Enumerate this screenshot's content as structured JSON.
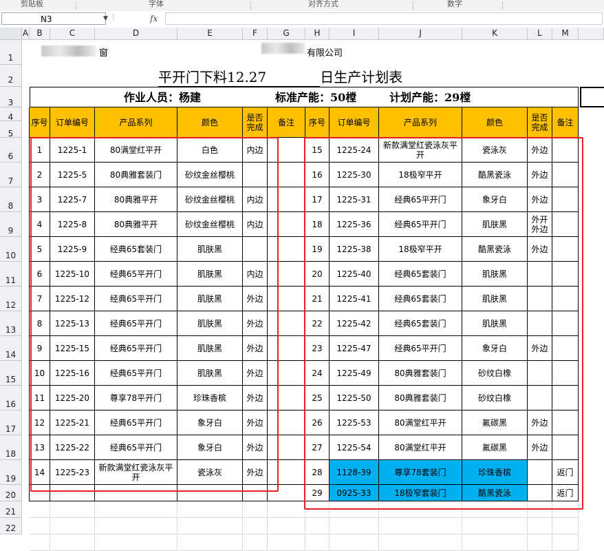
{
  "ribbon": {
    "groups": [
      "剪贴板",
      "字体",
      "对齐方式",
      "数字"
    ]
  },
  "formula_bar": {
    "name_box": "N3",
    "fx_label": "fx",
    "formula": ""
  },
  "columns": [
    "A",
    "B",
    "C",
    "D",
    "E",
    "F",
    "G",
    "H",
    "I",
    "J",
    "K",
    "L",
    "M"
  ],
  "rows": [
    "1",
    "2",
    "3",
    "4",
    "5",
    "6",
    "7",
    "8",
    "9",
    "10",
    "11",
    "12",
    "13",
    "14",
    "15",
    "16",
    "17",
    "18",
    "19",
    "20",
    "21",
    "22"
  ],
  "sheet": {
    "company_tail": "有限公司",
    "company_head_char": "窗",
    "title_prefix": "平开门下料12.27",
    "title_suffix": "日生产计划表",
    "worker": "作业人员：杨建",
    "standard_capacity": "标准产能：50樘",
    "planned_capacity": "计划产能：29樘"
  },
  "headers": [
    "序号",
    "订单编号",
    "产品系列",
    "颜色",
    "是否完成",
    "备注"
  ],
  "left_rows": [
    {
      "no": "1",
      "order": "1225-1",
      "series": "80满堂红平开",
      "color": "白色",
      "done": "内边",
      "note": ""
    },
    {
      "no": "2",
      "order": "1225-5",
      "series": "80典雅套装门",
      "color": "砂纹金丝樱桃",
      "done": "",
      "note": ""
    },
    {
      "no": "3",
      "order": "1225-7",
      "series": "80典雅平开",
      "color": "砂纹金丝樱桃",
      "done": "内边",
      "note": ""
    },
    {
      "no": "4",
      "order": "1225-8",
      "series": "80典雅平开",
      "color": "砂纹金丝樱桃",
      "done": "内边",
      "note": ""
    },
    {
      "no": "5",
      "order": "1225-9",
      "series": "经典65套装门",
      "color": "肌肤黑",
      "done": "",
      "note": ""
    },
    {
      "no": "6",
      "order": "1225-10",
      "series": "经典65平开门",
      "color": "肌肤黑",
      "done": "内边",
      "note": ""
    },
    {
      "no": "7",
      "order": "1225-12",
      "series": "经典65平开门",
      "color": "肌肤黑",
      "done": "外边",
      "note": ""
    },
    {
      "no": "8",
      "order": "1225-13",
      "series": "经典65平开门",
      "color": "肌肤黑",
      "done": "外边",
      "note": ""
    },
    {
      "no": "9",
      "order": "1225-15",
      "series": "经典65平开门",
      "color": "肌肤黑",
      "done": "外边",
      "note": ""
    },
    {
      "no": "10",
      "order": "1225-16",
      "series": "经典65平开门",
      "color": "肌肤黑",
      "done": "外边",
      "note": ""
    },
    {
      "no": "11",
      "order": "1225-20",
      "series": "尊享78平开门",
      "color": "珍珠香槟",
      "done": "外边",
      "note": ""
    },
    {
      "no": "12",
      "order": "1225-21",
      "series": "经典65平开门",
      "color": "象牙白",
      "done": "外边",
      "note": ""
    },
    {
      "no": "13",
      "order": "1225-22",
      "series": "经典65平开门",
      "color": "象牙白",
      "done": "外边",
      "note": ""
    },
    {
      "no": "14",
      "order": "1225-23",
      "series": "新款满堂红瓷泳灰平开",
      "color": "瓷泳灰",
      "done": "外边",
      "note": ""
    }
  ],
  "right_rows": [
    {
      "no": "15",
      "order": "1225-24",
      "series": "新款满堂红瓷泳灰平开",
      "color": "瓷泳灰",
      "done": "外边",
      "note": ""
    },
    {
      "no": "16",
      "order": "1225-30",
      "series": "18极窄平开",
      "color": "酷黑瓷泳",
      "done": "外边",
      "note": ""
    },
    {
      "no": "17",
      "order": "1225-31",
      "series": "经典65平开门",
      "color": "象牙白",
      "done": "外边",
      "note": ""
    },
    {
      "no": "18",
      "order": "1225-36",
      "series": "经典65平开门",
      "color": "肌肤黑",
      "done": "外开外边",
      "note": ""
    },
    {
      "no": "19",
      "order": "1225-38",
      "series": "18极窄平开",
      "color": "酷黑瓷泳",
      "done": "外边",
      "note": ""
    },
    {
      "no": "20",
      "order": "1225-40",
      "series": "经典65套装门",
      "color": "肌肤黑",
      "done": "",
      "note": ""
    },
    {
      "no": "21",
      "order": "1225-41",
      "series": "经典65套装门",
      "color": "肌肤黑",
      "done": "",
      "note": ""
    },
    {
      "no": "22",
      "order": "1225-42",
      "series": "经典65套装门",
      "color": "肌肤黑",
      "done": "",
      "note": ""
    },
    {
      "no": "23",
      "order": "1225-47",
      "series": "经典65平开门",
      "color": "象牙白",
      "done": "外边",
      "note": ""
    },
    {
      "no": "24",
      "order": "1225-49",
      "series": "80典雅套装门",
      "color": "砂纹白橡",
      "done": "",
      "note": ""
    },
    {
      "no": "25",
      "order": "1225-50",
      "series": "80典雅套装门",
      "color": "砂纹白橡",
      "done": "",
      "note": ""
    },
    {
      "no": "26",
      "order": "1225-53",
      "series": "80满堂红平开",
      "color": "氟碳黑",
      "done": "外边",
      "note": ""
    },
    {
      "no": "27",
      "order": "1225-54",
      "series": "80满堂红平开",
      "color": "氟碳黑",
      "done": "外边",
      "note": ""
    },
    {
      "no": "28",
      "order": "1128-39",
      "series": "尊享78套装门",
      "color": "珍珠香槟",
      "done": "",
      "note": "返门"
    },
    {
      "no": "29",
      "order": "0925-33",
      "series": "18极窄套装门",
      "color": "酷黑瓷泳",
      "done": "",
      "note": "返门"
    }
  ],
  "colors": {
    "header_fill": "#ffc000",
    "highlight_fill": "#00b0f0",
    "annotation": "#e82020"
  }
}
